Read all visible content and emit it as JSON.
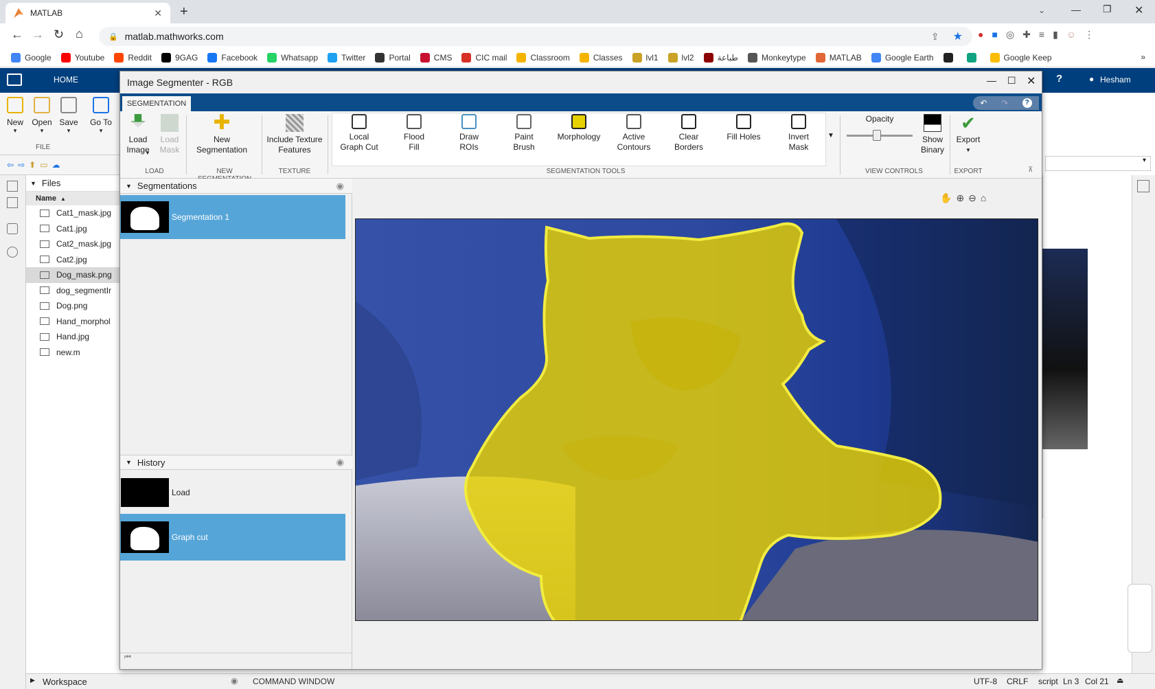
{
  "browser": {
    "tab_title": "MATLAB",
    "url": "matlab.mathworks.com",
    "bookmarks": [
      {
        "label": "Google",
        "color": "#4285f4"
      },
      {
        "label": "Youtube",
        "color": "#ff0000"
      },
      {
        "label": "Reddit",
        "color": "#ff4500"
      },
      {
        "label": "9GAG",
        "color": "#000000"
      },
      {
        "label": "Facebook",
        "color": "#1877f2"
      },
      {
        "label": "Whatsapp",
        "color": "#25d366"
      },
      {
        "label": "Twitter",
        "color": "#1da1f2"
      },
      {
        "label": "Portal",
        "color": "#333333"
      },
      {
        "label": "CMS",
        "color": "#c8102e"
      },
      {
        "label": "CIC mail",
        "color": "#d93025"
      },
      {
        "label": "Classroom",
        "color": "#f4b400"
      },
      {
        "label": "Classes",
        "color": "#f4b400"
      },
      {
        "label": "lvl1",
        "color": "#c9a227"
      },
      {
        "label": "lvl2",
        "color": "#c9a227"
      },
      {
        "label": "طباعة",
        "color": "#8b0000"
      },
      {
        "label": "Monkeytype",
        "color": "#555555"
      },
      {
        "label": "MATLAB",
        "color": "#e16737"
      },
      {
        "label": "Google Earth",
        "color": "#4285f4"
      },
      {
        "label": "",
        "color": "#222222"
      },
      {
        "label": "",
        "color": "#10a37f"
      },
      {
        "label": "Google Keep",
        "color": "#fbbc04"
      }
    ]
  },
  "matlab": {
    "home_tab": "HOME",
    "user": "Hesham",
    "strip_buttons": [
      {
        "label": "New",
        "icon": "plus-icon"
      },
      {
        "label": "Open",
        "icon": "folder-icon"
      },
      {
        "label": "Save",
        "icon": "save-icon"
      },
      {
        "label": "Go To",
        "icon": "goto-icon"
      }
    ],
    "file_section": "FILE",
    "files_header": "Files",
    "name_col": "Name",
    "files": [
      "Cat1_mask.jpg",
      "Cat1.jpg",
      "Cat2_mask.jpg",
      "Cat2.jpg",
      "Dog_mask.png",
      "dog_segmentIr",
      "Dog.png",
      "Hand_morphol",
      "Hand.jpg",
      "new.m"
    ],
    "workspace": "Workspace",
    "command_window": "COMMAND WINDOW",
    "status": {
      "encoding": "UTF-8",
      "eol": "CRLF",
      "type": "script",
      "ln": "Ln 3",
      "col": "Col 21"
    }
  },
  "app": {
    "title": "Image Segmenter - RGB",
    "tab": "SEGMENTATION",
    "ribbon": {
      "load_image": "Load\nImage",
      "load_mask": "Load\nMask",
      "new_segmentation": "New\nSegmentation",
      "include_texture": "Include Texture\nFeatures",
      "tools": [
        {
          "label": "Local\nGraph Cut",
          "icon": "graph-cut-icon"
        },
        {
          "label": "Flood\nFill",
          "icon": "flood-fill-icon"
        },
        {
          "label": "Draw\nROIs",
          "icon": "draw-roi-icon"
        },
        {
          "label": "Paint\nBrush",
          "icon": "paint-brush-icon"
        },
        {
          "label": "Morphology",
          "icon": "morphology-icon"
        },
        {
          "label": "Active\nContours",
          "icon": "active-contours-icon"
        },
        {
          "label": "Clear\nBorders",
          "icon": "clear-borders-icon"
        },
        {
          "label": "Fill Holes",
          "icon": "fill-holes-icon"
        },
        {
          "label": "Invert\nMask",
          "icon": "invert-mask-icon"
        }
      ],
      "opacity": "Opacity",
      "opacity_value": 0.45,
      "show_binary": "Show\nBinary",
      "export": "Export",
      "sections": {
        "load": "LOAD",
        "new_seg": "NEW SEGMENTATION",
        "texture": "TEXTURE",
        "tools": "SEGMENTATION TOOLS",
        "view": "VIEW CONTROLS",
        "export": "EXPORT"
      }
    },
    "segmentations_header": "Segmentations",
    "segmentations": [
      "Segmentation 1"
    ],
    "history_header": "History",
    "history": [
      "Load",
      "Graph cut"
    ],
    "colors": {
      "selected": "#56a5d8",
      "overlay": "#e8d100"
    }
  }
}
